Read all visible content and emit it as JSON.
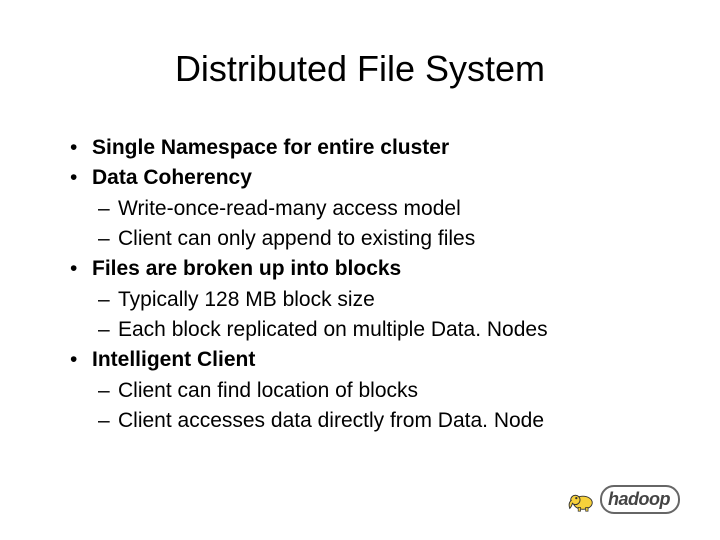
{
  "title": "Distributed File System",
  "bullets": {
    "b1": "Single Namespace for entire cluster",
    "b2": "Data Coherency",
    "b2a": "Write-once-read-many access model",
    "b2b": "Client can only append to existing files",
    "b3": "Files are broken up into blocks",
    "b3a": "Typically 128 MB block size",
    "b3b": "Each block replicated on multiple Data. Nodes",
    "b4": "Intelligent Client",
    "b4a": "Client can find location of blocks",
    "b4b": "Client accesses data directly from Data. Node"
  },
  "logo": {
    "text": "hadoop",
    "icon": "hadoop-elephant-icon"
  }
}
